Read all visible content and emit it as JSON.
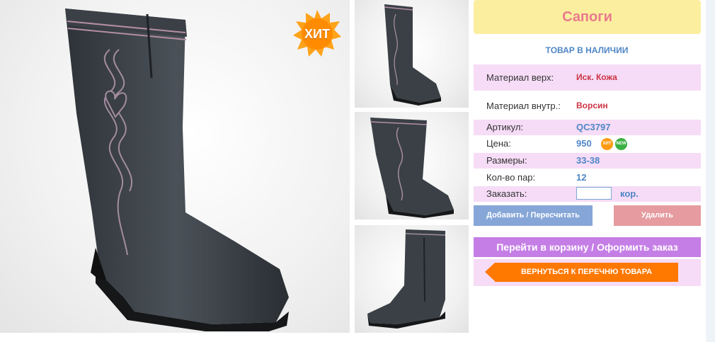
{
  "product": {
    "title": "Сапоги",
    "stock_status": "ТОВАР В НАЛИЧИИ",
    "hit_badge": "ХИТ",
    "small_badges": {
      "hit": "ХИТ",
      "new": "NEW"
    }
  },
  "details": [
    {
      "label": "Материал верх:",
      "value": "Иск. Кожа"
    },
    {
      "label": "Материал внутр.:",
      "value": "Ворсин"
    },
    {
      "label": "Артикул:",
      "value": "QC3797"
    },
    {
      "label": "Цена:",
      "value": "950"
    },
    {
      "label": "Размеры:",
      "value": "33-38"
    },
    {
      "label": "Кол-во пар:",
      "value": "12"
    }
  ],
  "order": {
    "label": "Заказать:",
    "input_value": "",
    "unit": "кор."
  },
  "buttons": {
    "add": "Добавить / Пересчитать",
    "delete": "Удалить",
    "cart": "Перейти в корзину / Оформить заказ",
    "back": "ВЕРНУТЬСЯ К ПЕРЕЧНЮ ТОВАРА"
  },
  "colors": {
    "title_bg": "#fbee9e",
    "title_text": "#ea7a8e",
    "accent_blue": "#4f86c6",
    "row_pink": "#f6dcf6",
    "add_button": "#86a6d8",
    "delete_button": "#e59b9f",
    "cart_button": "#c57ee6",
    "back_button": "#ff7800"
  }
}
